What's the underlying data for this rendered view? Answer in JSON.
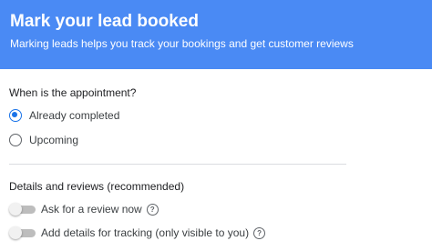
{
  "header": {
    "title": "Mark your lead booked",
    "subtitle": "Marking leads helps you track your bookings and get customer reviews",
    "background_color": "#4a8af4"
  },
  "appointment": {
    "question": "When is the appointment?",
    "options": [
      {
        "label": "Already completed",
        "selected": true
      },
      {
        "label": "Upcoming",
        "selected": false
      }
    ]
  },
  "details": {
    "heading": "Details and reviews (recommended)",
    "toggles": [
      {
        "label": "Ask for a review now",
        "on": false,
        "icon": "help-icon"
      },
      {
        "label": "Add details for tracking (only visible to you)",
        "on": false,
        "icon": "help-icon"
      }
    ]
  },
  "colors": {
    "accent": "#1a73e8",
    "divider": "#dadce0"
  }
}
